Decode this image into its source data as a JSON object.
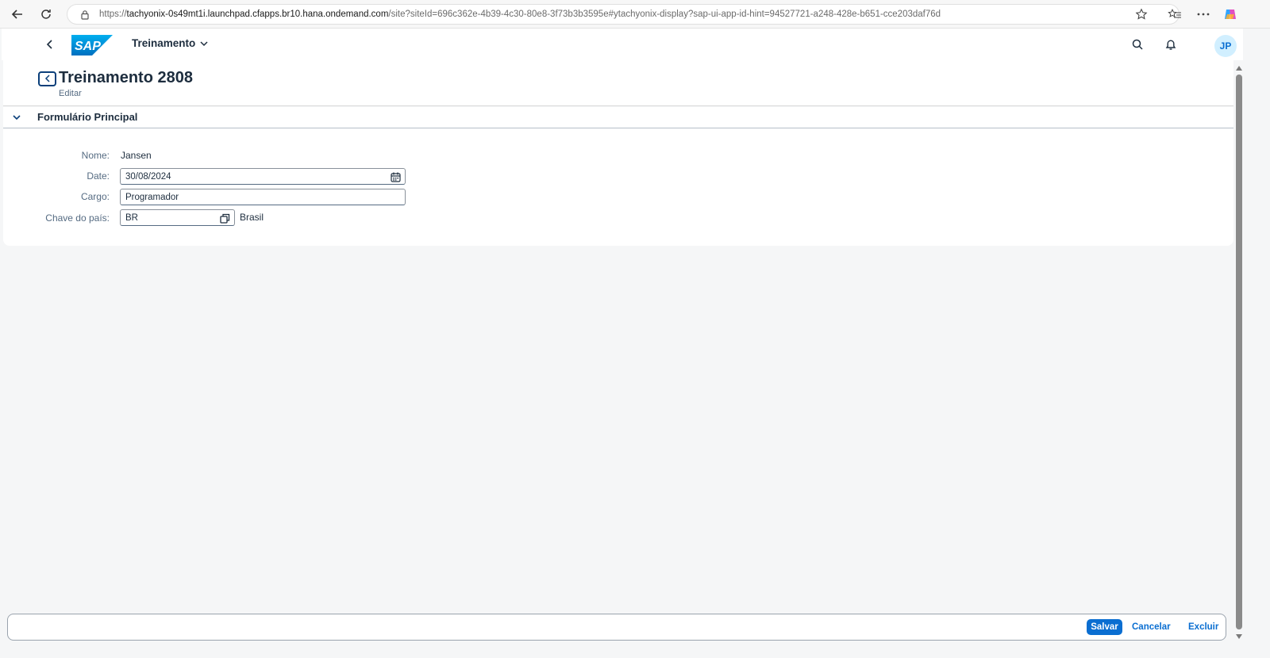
{
  "browser": {
    "url_prefix": "https://",
    "url_domain": "tachyonix-0s49mt1i.launchpad.cfapps.br10.hana.ondemand.com",
    "url_rest": "/site?siteId=696c362e-4b39-4c30-80e8-3f73b3b3595e#ytachyonix-display?sap-ui-app-id-hint=94527721-a248-428e-b651-cce203daf76d"
  },
  "shell": {
    "logo_text": "SAP",
    "app_title": "Treinamento",
    "user_initials": "JP"
  },
  "header": {
    "title": "Treinamento 2808",
    "subtitle": "Editar"
  },
  "section": {
    "title": "Formulário Principal",
    "fields": {
      "nome_label": "Nome:",
      "nome_value": "Jansen",
      "date_label": "Date:",
      "date_value": "30/08/2024",
      "cargo_label": "Cargo:",
      "cargo_value": "Programador",
      "pais_label": "Chave do país:",
      "pais_value": "BR",
      "pais_text": "Brasil"
    }
  },
  "footer": {
    "save_label": "Salvar",
    "cancel_label": "Cancelar",
    "delete_label": "Excluir"
  },
  "colors": {
    "accent": "#0a6ed1",
    "brand_logo": "#0a6ed1"
  }
}
